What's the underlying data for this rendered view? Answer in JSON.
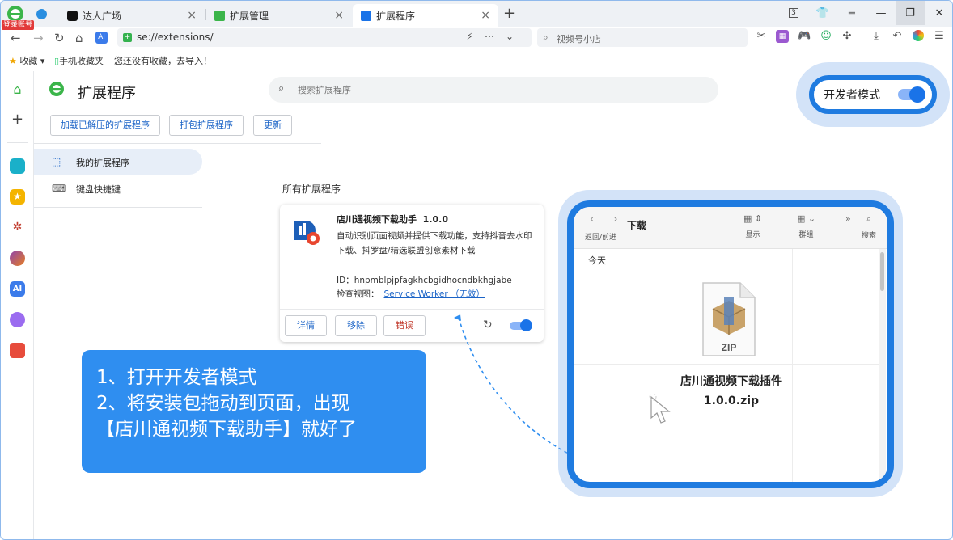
{
  "browser": {
    "login_badge": "登录账号",
    "tabs": [
      {
        "label": "达人广场",
        "icon": "tiktok-icon",
        "active": false
      },
      {
        "label": "扩展管理",
        "icon": "puzzle-icon",
        "active": false
      },
      {
        "label": "扩展程序",
        "icon": "puzzle-icon",
        "active": true
      }
    ],
    "new_tab": "+",
    "tab_counter": "3",
    "address": "se://extensions/",
    "search_placeholder": "视频号小店"
  },
  "bookmarks": {
    "favorites": "收藏",
    "mobile": "手机收藏夹",
    "import_hint": "您还没有收藏，去导入！"
  },
  "extensions": {
    "title": "扩展程序",
    "search_placeholder": "搜索扩展程序",
    "dev_mode_label": "开发者模式",
    "dev_mode_on": true,
    "buttons": {
      "load_unpacked": "加载已解压的扩展程序",
      "pack": "打包扩展程序",
      "update": "更新"
    },
    "nav": {
      "my_extensions": "我的扩展程序",
      "shortcuts": "键盘快捷键"
    },
    "section_label": "所有扩展程序",
    "card": {
      "name": "店川通视频下载助手",
      "version": "1.0.0",
      "description": "自动识别页面视频并提供下载功能，支持抖音去水印下载、抖罗盘/精选联盟创意素材下载",
      "id_label": "ID：",
      "id": "hnpmblpjpfagkhcbgidhocndbkhgjabe",
      "inspect_label": "检查视图：",
      "inspect_link": "Service Worker （无效）",
      "details": "详情",
      "remove": "移除",
      "errors": "错误",
      "enabled": true
    }
  },
  "instructions": {
    "line1": "1、打开开发者模式",
    "line2": "2、将安装包拖动到页面，出现",
    "line3": "【店川通视频下载助手】就好了"
  },
  "finder": {
    "title": "下载",
    "nav_label": "返回/前进",
    "view_label": "显示",
    "group_label": "群组",
    "search_label": "搜索",
    "today": "今天",
    "file_name": "店川通视频下载插件1.0.0.zip",
    "file_badge": "ZIP"
  },
  "colors": {
    "accent": "#1f7be0",
    "instruction_bg": "#2f8ef0",
    "link": "#1a63c7",
    "error": "#c0392b"
  }
}
